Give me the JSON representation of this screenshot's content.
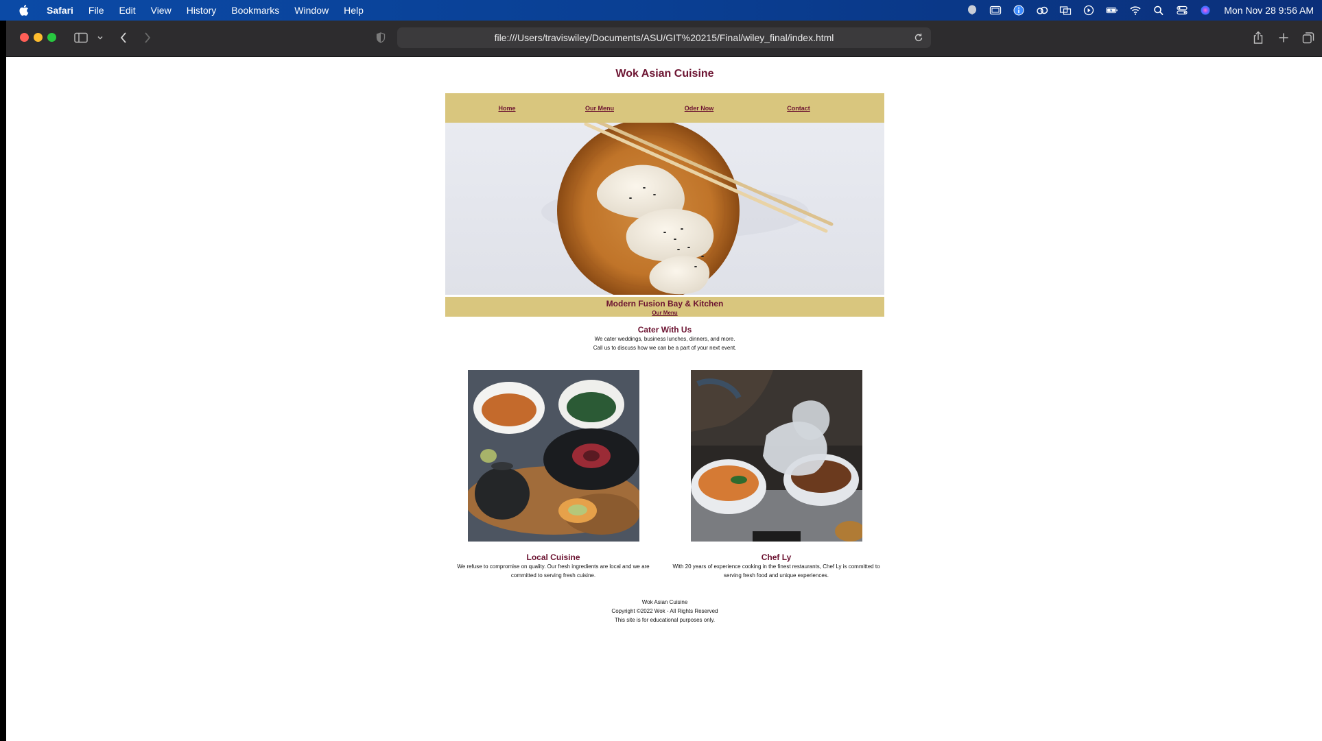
{
  "menubar": {
    "app": "Safari",
    "items": [
      "File",
      "Edit",
      "View",
      "History",
      "Bookmarks",
      "Window",
      "Help"
    ],
    "clock": "Mon Nov 28  9:56 AM"
  },
  "browser": {
    "url": "file:///Users/traviswiley/Documents/ASU/GIT%20215/Final/wiley_final/index.html"
  },
  "site": {
    "title": "Wok Asian Cuisine",
    "nav": [
      "Home",
      "Our Menu",
      "Oder Now",
      "Contact"
    ],
    "banner_title": "Modern Fusion Bay & Kitchen",
    "banner_link": "Our Menu",
    "cater": {
      "heading": "Cater With Us",
      "line1": "We cater weddings, business lunches, dinners, and more.",
      "line2": "Call us to discuss how we can be a part of your next event."
    },
    "cards": [
      {
        "heading": "Local Cuisine",
        "text": "We refuse to compromise on quality. Our fresh ingredients are local and we are committed to serving fresh cuisine."
      },
      {
        "heading": "Chef Ly",
        "text": "With 20 years of experience cooking in the finest restaurants, Chef Ly is committed to serving fresh food and unique experiences."
      }
    ],
    "footer": {
      "line1": "Wok Asian Cuisine",
      "line2": "Copyright ©2022 Wok - All Rights Reserved",
      "line3": "This site is for educational purposes only."
    }
  },
  "colors": {
    "accent": "#6b1230",
    "nav_bg": "#d9c67e",
    "menubar": "#0b4aa6",
    "toolbar": "#2d2c2e"
  }
}
